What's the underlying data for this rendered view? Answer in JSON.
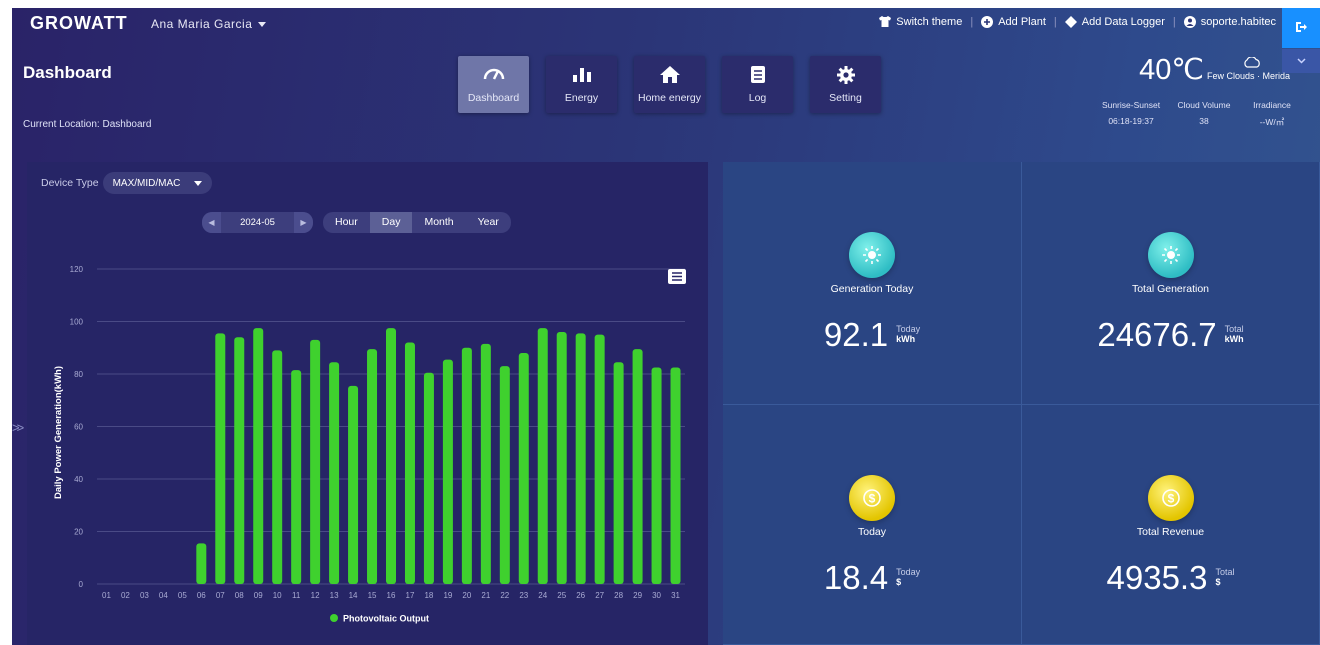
{
  "header": {
    "logo": "GROWATT",
    "user": "Ana Maria Garcia",
    "links": [
      {
        "label": "Switch theme",
        "icon": "shirt-icon"
      },
      {
        "label": "Add Plant",
        "icon": "plus-circle-icon"
      },
      {
        "label": "Add Data Logger",
        "icon": "logger-icon"
      },
      {
        "label": "soporte.habitec",
        "icon": "user-circle-icon"
      }
    ],
    "logout_icon": "logout-icon",
    "collapse_icon": "chevron-down-icon"
  },
  "page": {
    "title": "Dashboard",
    "location": "Current Location: Dashboard"
  },
  "nav": [
    {
      "label": "Dashboard",
      "icon": "gauge-icon",
      "active": true
    },
    {
      "label": "Energy",
      "icon": "bar-chart-icon",
      "active": false
    },
    {
      "label": "Home energy",
      "icon": "home-icon",
      "active": false
    },
    {
      "label": "Log",
      "icon": "log-icon",
      "active": false
    },
    {
      "label": "Setting",
      "icon": "gear-icon",
      "active": false
    }
  ],
  "weather": {
    "temp": "40℃",
    "desc": "Few Clouds · Merida",
    "stats": [
      {
        "label": "Sunrise-Sunset",
        "value": "06:18-19:37"
      },
      {
        "label": "Cloud Volume",
        "value": "38"
      },
      {
        "label": "Irradiance",
        "value": "--W/㎡"
      }
    ]
  },
  "filters": {
    "device_type_label": "Device Type",
    "device_type_value": "MAX/MID/MAC",
    "date": "2024-05",
    "ranges": [
      {
        "label": "Hour",
        "active": false
      },
      {
        "label": "Day",
        "active": true
      },
      {
        "label": "Month",
        "active": false
      },
      {
        "label": "Year",
        "active": false
      }
    ]
  },
  "chart_data": {
    "type": "bar",
    "title": "",
    "xlabel": "",
    "ylabel": "Daily Power Generation(kWh)",
    "ylim": [
      0,
      120
    ],
    "yticks": [
      0,
      20,
      40,
      60,
      80,
      100,
      120
    ],
    "grid": true,
    "legend_position": "bottom-center",
    "categories": [
      "01",
      "02",
      "03",
      "04",
      "05",
      "06",
      "07",
      "08",
      "09",
      "10",
      "11",
      "12",
      "13",
      "14",
      "15",
      "16",
      "17",
      "18",
      "19",
      "20",
      "21",
      "22",
      "23",
      "24",
      "25",
      "26",
      "27",
      "28",
      "29",
      "30",
      "31"
    ],
    "series": [
      {
        "name": "Photovoltaic Output",
        "color": "#3fd12e",
        "values": [
          0,
          0,
          0,
          0,
          0,
          15.5,
          95.5,
          94,
          97.5,
          89,
          81.5,
          93,
          84.5,
          75.5,
          89.5,
          97.5,
          92,
          80.5,
          85.5,
          90,
          91.5,
          83,
          88,
          97.5,
          96,
          95.5,
          95,
          84.5,
          89.5,
          82.5,
          82.5
        ]
      }
    ]
  },
  "stats": [
    {
      "label": "Generation Today",
      "value": "92.1",
      "unit_top": "Today",
      "unit_bottom": "kWh",
      "icon": "sun-icon",
      "icon_color": "teal"
    },
    {
      "label": "Total Generation",
      "value": "24676.7",
      "unit_top": "Total",
      "unit_bottom": "kWh",
      "icon": "sun-icon",
      "icon_color": "teal"
    },
    {
      "label": "Today",
      "value": "18.4",
      "unit_top": "Today",
      "unit_bottom": "$",
      "icon": "coin-icon",
      "icon_color": "gold"
    },
    {
      "label": "Total Revenue",
      "value": "4935.3",
      "unit_top": "Total",
      "unit_bottom": "$",
      "icon": "coin-icon",
      "icon_color": "gold"
    }
  ]
}
